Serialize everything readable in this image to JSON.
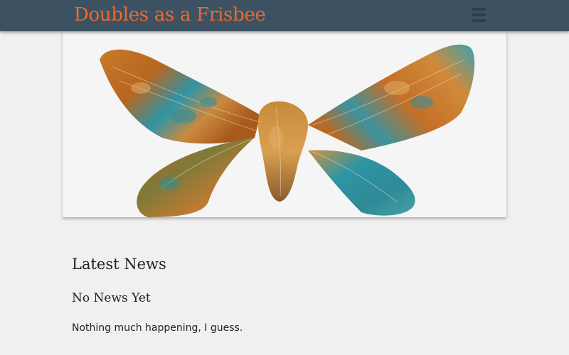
{
  "header": {
    "site_title": "Doubles as a Frisbee",
    "menu_icon": "hamburger-menu-icon",
    "title_color": "#f2682b",
    "bar_color": "#3c5262"
  },
  "hero": {
    "image": "painted-butterfly-moth"
  },
  "news": {
    "heading": "Latest News",
    "posts": [
      {
        "title": "No News Yet",
        "body": "Nothing much happening, I guess."
      }
    ]
  }
}
